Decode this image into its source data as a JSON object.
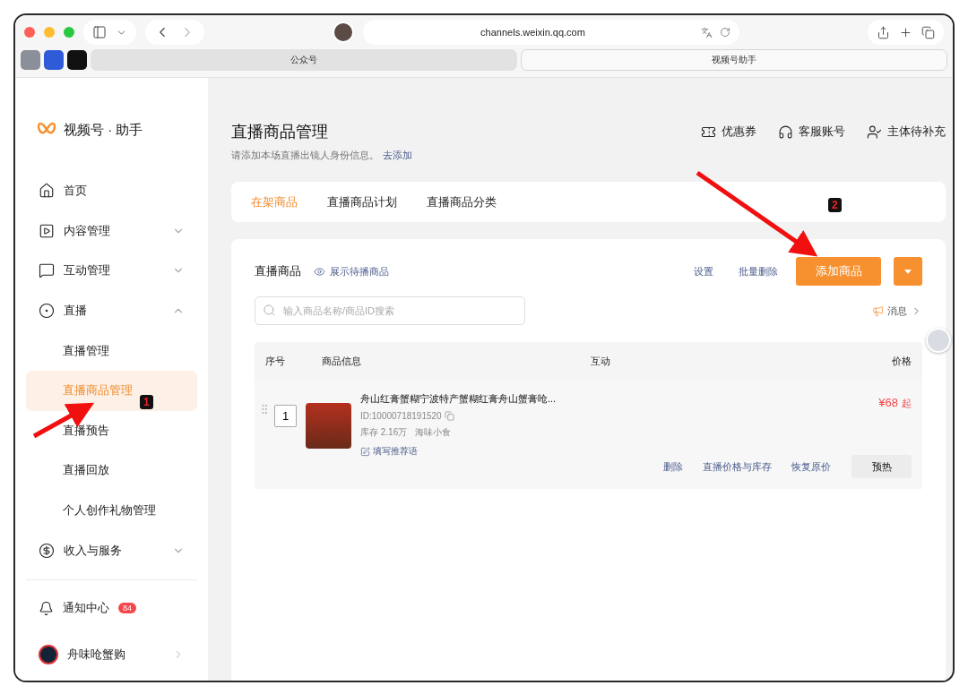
{
  "browser": {
    "url": "channels.weixin.qq.com",
    "tabs": [
      {
        "label": "公众号",
        "selected": false
      },
      {
        "label": "视频号助手",
        "selected": true
      }
    ]
  },
  "sidebar": {
    "brand": "视频号 · 助手",
    "items": [
      {
        "label": "首页"
      },
      {
        "label": "内容管理",
        "expanded": false
      },
      {
        "label": "互动管理",
        "expanded": false
      },
      {
        "label": "直播",
        "expanded": true,
        "children": [
          {
            "label": "直播管理",
            "selected": false
          },
          {
            "label": "直播商品管理",
            "selected": true
          },
          {
            "label": "直播预告",
            "selected": false
          },
          {
            "label": "直播回放",
            "selected": false
          },
          {
            "label": "个人创作礼物管理",
            "selected": false
          }
        ]
      },
      {
        "label": "收入与服务",
        "expanded": false
      }
    ],
    "notification": {
      "label": "通知中心",
      "count": "84"
    },
    "account": {
      "name": "舟味呛蟹购"
    }
  },
  "main": {
    "title": "直播商品管理",
    "notice": {
      "text": "请添加本场直播出镜人身份信息。",
      "link": "去添加"
    },
    "actions": [
      "优惠券",
      "客服账号",
      "主体待补充"
    ],
    "tabs": [
      {
        "label": "在架商品",
        "selected": true
      },
      {
        "label": "直播商品计划",
        "selected": false
      },
      {
        "label": "直播商品分类",
        "selected": false
      }
    ],
    "panel": {
      "title": "直播商品",
      "toggle": "展示待播商品",
      "links": [
        "设置",
        "批量删除"
      ],
      "primary_button": "添加商品",
      "search_placeholder": "输入商品名称/商品ID搜索",
      "message": "消息",
      "columns": [
        "序号",
        "商品信息",
        "互动",
        "价格"
      ],
      "rows": [
        {
          "index": "1",
          "name": "舟山红膏蟹糊宁波特产蟹糊红膏舟山蟹膏呛...",
          "id": "ID:10000718191520",
          "stock": "库存 2.16万",
          "shop": "海味小食",
          "recommend": "填写推荐语",
          "price": "¥68",
          "price_suffix": "起",
          "actions": [
            "删除",
            "直播价格与库存",
            "恢复原价"
          ],
          "button": "预热"
        }
      ]
    }
  },
  "annotations": [
    {
      "label": "1"
    },
    {
      "label": "2"
    }
  ]
}
